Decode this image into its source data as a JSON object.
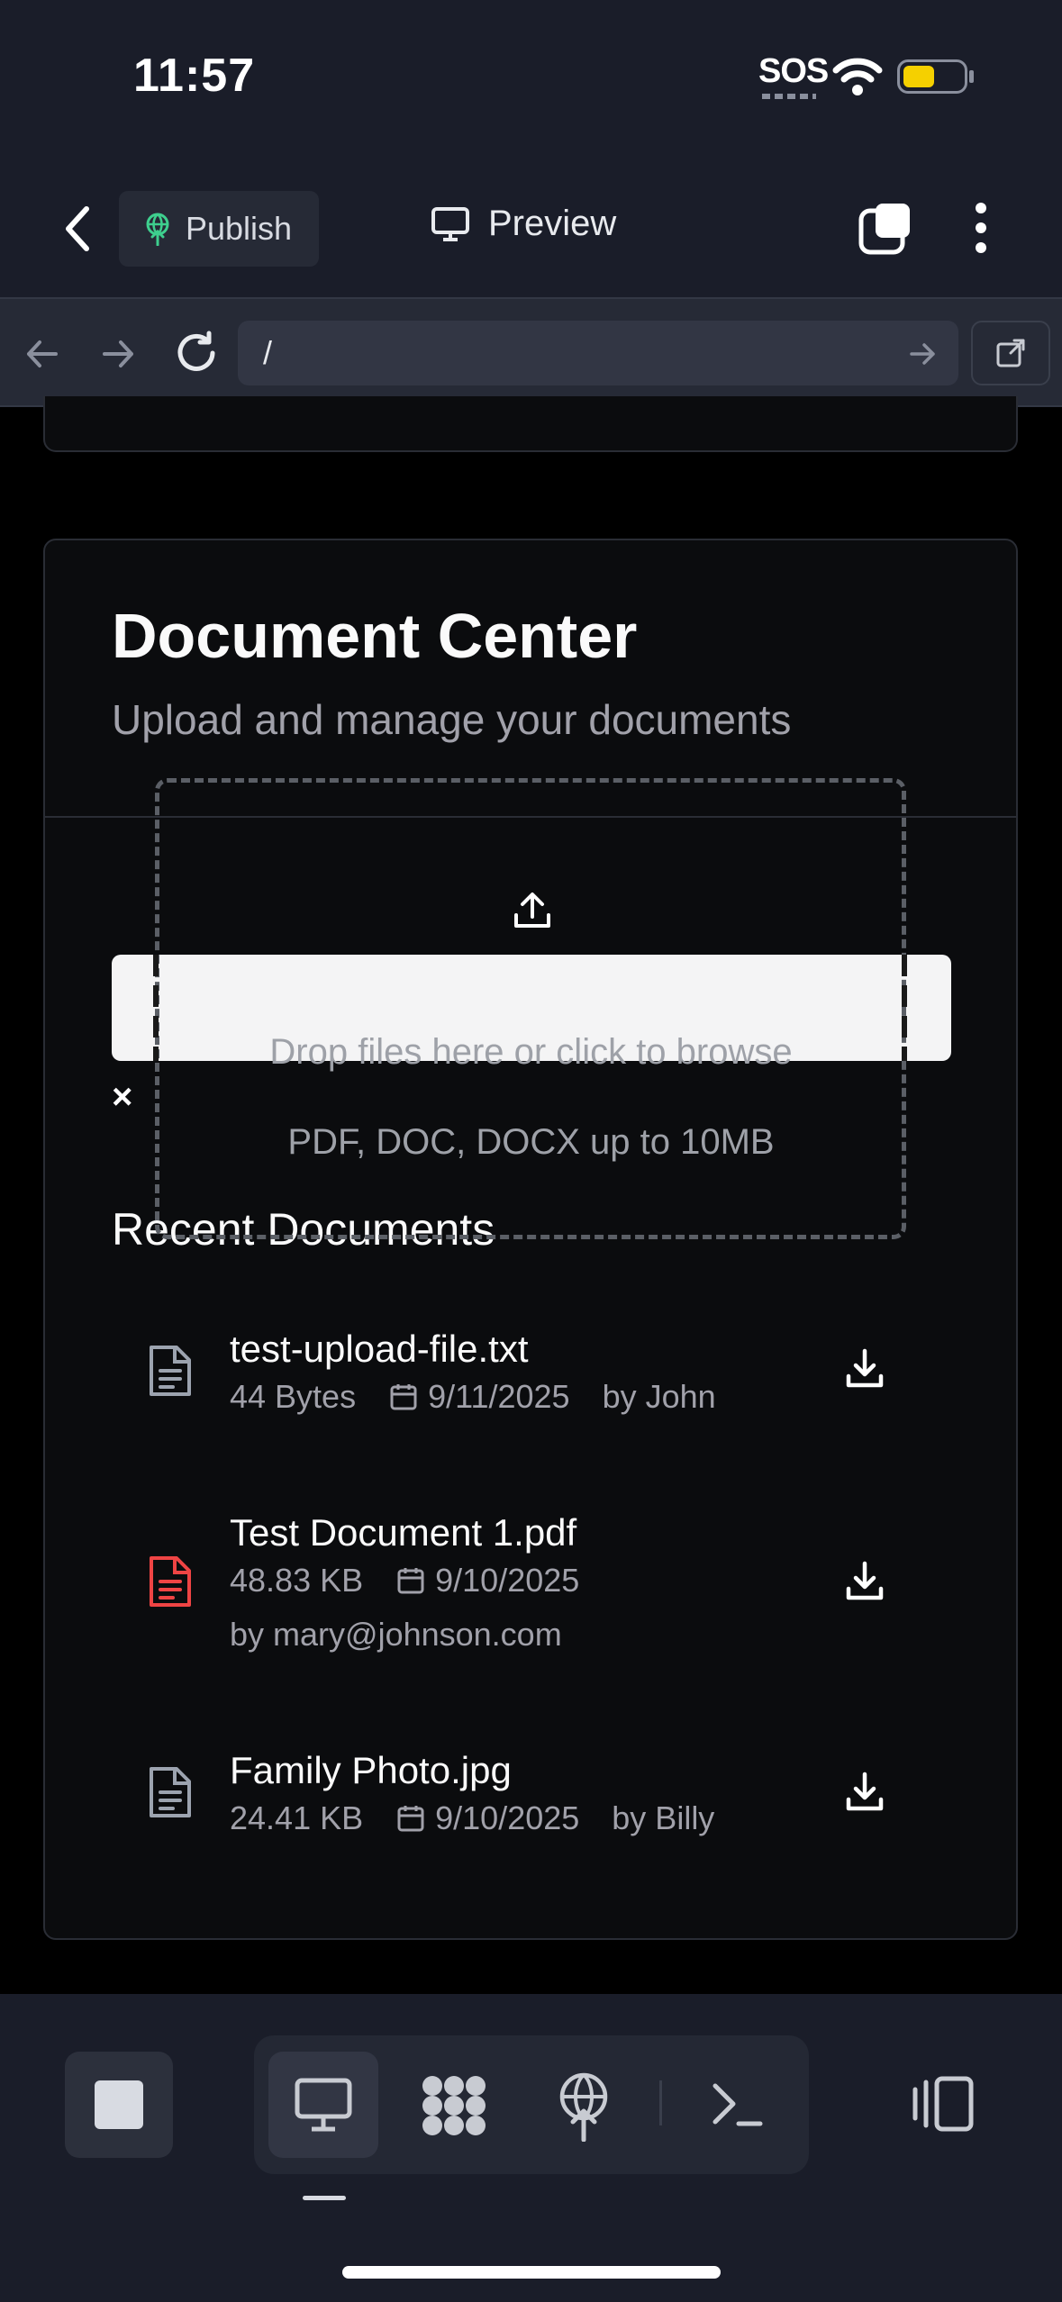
{
  "status_bar": {
    "time": "11:57",
    "sos": "SOS",
    "icons": [
      "wifi-icon",
      "battery-icon"
    ],
    "battery_color": "#f5d000"
  },
  "header": {
    "back_icon": "chevron-left-icon",
    "publish_label": "Publish",
    "preview_label": "Preview",
    "icons": [
      "tabs-icon",
      "more-vertical-icon"
    ]
  },
  "url_bar": {
    "url": "/",
    "icons": [
      "arrow-left-icon",
      "arrow-right-icon",
      "reload-icon",
      "go-icon",
      "external-link-icon"
    ]
  },
  "document_center": {
    "title": "Document Center",
    "subtitle": "Upload and manage your documents",
    "dropzone": {
      "icon": "upload-icon",
      "text": "Drop files here or click to browse",
      "hint": "PDF, DOC, DOCX up to 10MB",
      "close_label": "×"
    },
    "recent_title": "Recent Documents",
    "documents": [
      {
        "name": "test-upload-file.txt",
        "size": "44 Bytes",
        "date": "9/11/2025",
        "author": "by John",
        "icon_color": "#9ca3af"
      },
      {
        "name": "Test Document 1.pdf",
        "size": "48.83 KB",
        "date": "9/10/2025",
        "author": "by mary@johnson.com",
        "icon_color": "#ef4444"
      },
      {
        "name": "Family Photo.jpg",
        "size": "24.41 KB",
        "date": "9/10/2025",
        "author": "by Billy",
        "icon_color": "#9ca3af"
      }
    ]
  },
  "bottom_bar": {
    "icons": [
      "stop-icon",
      "desktop-icon",
      "apps-icon",
      "publish-icon",
      "terminal-icon",
      "split-view-icon"
    ],
    "active_tab": "desktop-icon"
  }
}
